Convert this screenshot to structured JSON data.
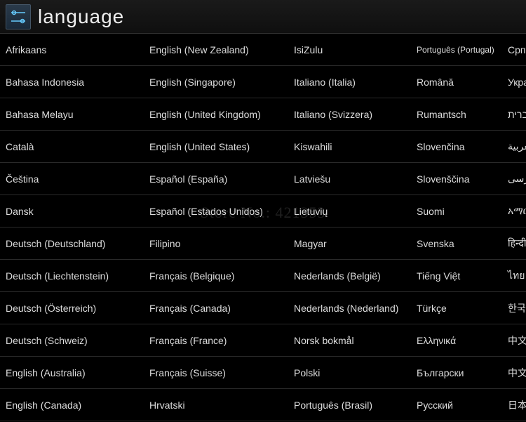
{
  "header": {
    "title": "language"
  },
  "watermark": "Store No.: 421353",
  "languages": {
    "col0": [
      "Afrikaans",
      "Bahasa Indonesia",
      "Bahasa Melayu",
      "Català",
      "Čeština",
      "Dansk",
      "Deutsch (Deutschland)",
      "Deutsch (Liechtenstein)",
      "Deutsch (Österreich)",
      "Deutsch (Schweiz)",
      "English (Australia)",
      "English (Canada)"
    ],
    "col1": [
      "English (New Zealand)",
      "English (Singapore)",
      "English (United Kingdom)",
      "English (United States)",
      "Español (España)",
      "Español (Estados Unidos)",
      "Filipino",
      "Français (Belgique)",
      "Français (Canada)",
      "Français (France)",
      "Français (Suisse)",
      "Hrvatski"
    ],
    "col2": [
      "IsiZulu",
      "Italiano (Italia)",
      "Italiano (Svizzera)",
      "Kiswahili",
      "Latviešu",
      "Lietuvių",
      "Magyar",
      "Nederlands (België)",
      "Nederlands (Nederland)",
      "Norsk bokmål",
      "Polski",
      "Português (Brasil)"
    ],
    "col3": [
      "Português (Portugal)",
      "Română",
      "Rumantsch",
      "Slovenčina",
      "Slovenščina",
      "Suomi",
      "Svenska",
      "Tiếng Việt",
      "Türkçe",
      "Ελληνικά",
      "Български",
      "Русский"
    ],
    "col4": [
      "Српски",
      "Українська",
      "עברית",
      "العربية",
      "فارسی",
      "አማርኛ",
      "हिन्दी",
      "ไทย",
      "한국어",
      "中文 (简体)",
      "中文 (繁體)",
      "日本語"
    ]
  }
}
